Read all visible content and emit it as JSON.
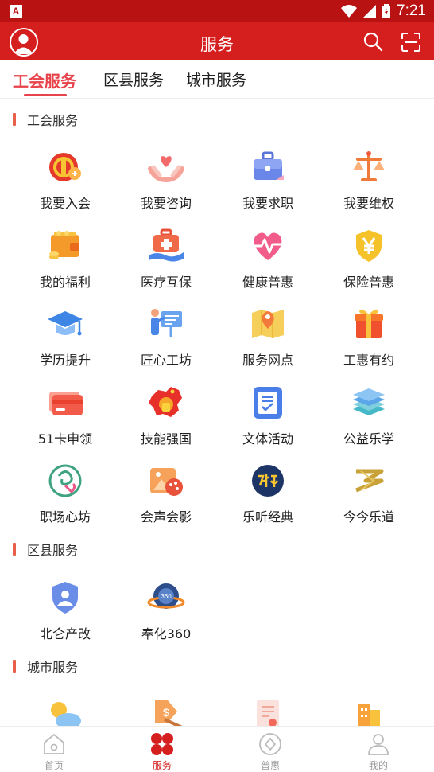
{
  "status_bar": {
    "time": "7:21"
  },
  "app_bar": {
    "title": "服务"
  },
  "tabs": [
    {
      "label": "工会服务",
      "active": true
    },
    {
      "label": "区县服务",
      "active": false
    },
    {
      "label": "城市服务",
      "active": false
    }
  ],
  "sections": {
    "union": {
      "title": "工会服务",
      "items": [
        {
          "label": "我要入会",
          "icon": "union-badge-icon"
        },
        {
          "label": "我要咨询",
          "icon": "heart-hands-icon"
        },
        {
          "label": "我要求职",
          "icon": "briefcase-icon"
        },
        {
          "label": "我要维权",
          "icon": "scales-icon"
        },
        {
          "label": "我的福利",
          "icon": "wallet-coins-icon"
        },
        {
          "label": "医疗互保",
          "icon": "medical-kit-icon"
        },
        {
          "label": "健康普惠",
          "icon": "heartbeat-icon"
        },
        {
          "label": "保险普惠",
          "icon": "shield-yen-icon"
        },
        {
          "label": "学历提升",
          "icon": "graduation-cap-icon"
        },
        {
          "label": "匠心工坊",
          "icon": "presenter-board-icon"
        },
        {
          "label": "服务网点",
          "icon": "map-pin-icon"
        },
        {
          "label": "工惠有约",
          "icon": "gift-icon"
        },
        {
          "label": "51卡申领",
          "icon": "card-icon"
        },
        {
          "label": "技能强国",
          "icon": "china-map-icon"
        },
        {
          "label": "文体活动",
          "icon": "notebook-check-icon"
        },
        {
          "label": "公益乐学",
          "icon": "books-icon"
        },
        {
          "label": "职场心坊",
          "icon": "heart-swirl-icon"
        },
        {
          "label": "会声会影",
          "icon": "image-palette-icon"
        },
        {
          "label": "乐听经典",
          "icon": "listen-logo-icon"
        },
        {
          "label": "今今乐道",
          "icon": "golden-logo-icon"
        }
      ]
    },
    "district": {
      "title": "区县服务",
      "items": [
        {
          "label": "北仑产改",
          "icon": "user-shield-icon"
        },
        {
          "label": "奉化360",
          "icon": "globe-360-icon"
        }
      ]
    },
    "city": {
      "title": "城市服务",
      "items": [
        {
          "icon": "weather-icon"
        },
        {
          "icon": "finance-icon"
        },
        {
          "icon": "certificate-icon"
        },
        {
          "icon": "building-icon"
        }
      ]
    }
  },
  "bottom_nav": [
    {
      "label": "首页",
      "icon": "home-icon",
      "active": false
    },
    {
      "label": "服务",
      "icon": "service-grid-icon",
      "active": true
    },
    {
      "label": "普惠",
      "icon": "diamond-circle-icon",
      "active": false
    },
    {
      "label": "我的",
      "icon": "profile-icon",
      "active": false
    }
  ],
  "colors": {
    "primary": "#d51f1f",
    "status_bar": "#b81212",
    "tab_active": "#e8424a",
    "section_bar": "#e8604a"
  }
}
